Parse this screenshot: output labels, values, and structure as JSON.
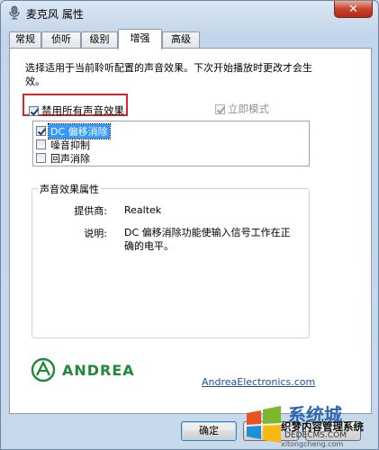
{
  "window": {
    "title": "麦克风 属性",
    "close_glyph": "✕"
  },
  "tabs": [
    {
      "label": "常规"
    },
    {
      "label": "侦听"
    },
    {
      "label": "级别"
    },
    {
      "label": "增强",
      "active": true
    },
    {
      "label": "高级"
    }
  ],
  "enhancements": {
    "description": "选择适用于当前聆听配置的声音效果。下次开始播放时更改才会生效。",
    "disable_all": {
      "label": "禁用所有声音效果",
      "checked": true
    },
    "immediate_mode": {
      "label": "立即模式",
      "checked": true,
      "enabled": false
    },
    "effects": [
      {
        "label": "DC 偏移消除",
        "checked": true,
        "selected": true
      },
      {
        "label": "噪音抑制",
        "checked": false
      },
      {
        "label": "回声消除",
        "checked": false
      }
    ],
    "properties": {
      "title": "声音效果属性",
      "provider_label": "提供商:",
      "provider_value": "Realtek",
      "desc_label": "说明:",
      "desc_value": "DC 偏移消除功能使输入信号工作在正确的电平。"
    },
    "logo": {
      "brand": "ANDREA",
      "link": "AndreaElectronics.com"
    }
  },
  "buttons": {
    "ok": "确定"
  },
  "watermark": {
    "brand_cn": "系统城",
    "line1": "织梦内容管理系统",
    "line2": "DEDECMS.COM",
    "line3": "xitongcheng.com"
  },
  "colors": {
    "highlight_border": "#d8262a",
    "selection": "#3399ff",
    "andrea_green": "#1f8a3a",
    "link": "#1e4f9e"
  }
}
